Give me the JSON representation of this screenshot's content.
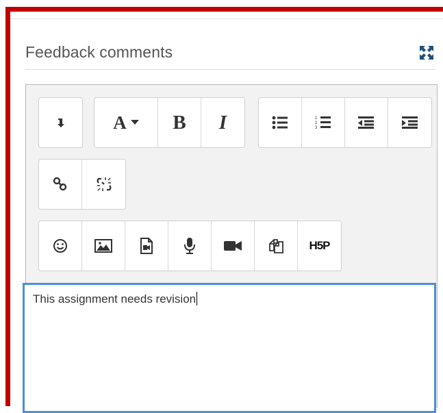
{
  "header": {
    "title": "Feedback comments"
  },
  "toolbar": {
    "toggle_icon": "arrow-down-icon",
    "font_label": "A",
    "bold_label": "B",
    "italic_label": "I",
    "h5p_label": "H5P"
  },
  "editor": {
    "text": "This assignment needs revision"
  },
  "colors": {
    "frame": "#c00000",
    "focus": "#4a90d9",
    "expand": "#1f4f7a"
  }
}
